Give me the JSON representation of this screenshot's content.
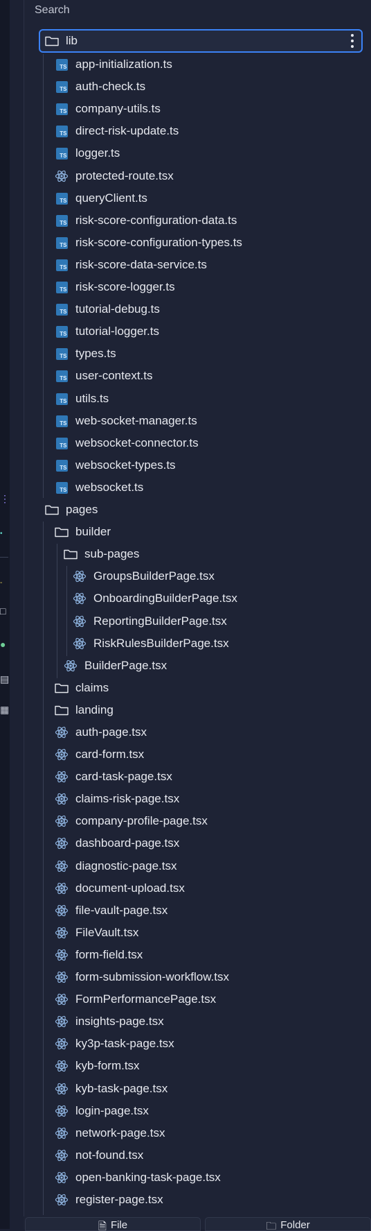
{
  "search": {
    "label": "Search"
  },
  "colors": {
    "accent": "#3b82f6",
    "ts_icon": "#2f78b7",
    "react_icon": "#8fb4e0"
  },
  "selected_folder": {
    "name": "lib",
    "icon": "folder-icon",
    "menu_icon": "more-vertical-icon"
  },
  "lib_files": [
    {
      "name": "app-initialization.ts",
      "icon": "ts-icon"
    },
    {
      "name": "auth-check.ts",
      "icon": "ts-icon"
    },
    {
      "name": "company-utils.ts",
      "icon": "ts-icon"
    },
    {
      "name": "direct-risk-update.ts",
      "icon": "ts-icon"
    },
    {
      "name": "logger.ts",
      "icon": "ts-icon"
    },
    {
      "name": "protected-route.tsx",
      "icon": "react-icon"
    },
    {
      "name": "queryClient.ts",
      "icon": "ts-icon"
    },
    {
      "name": "risk-score-configuration-data.ts",
      "icon": "ts-icon"
    },
    {
      "name": "risk-score-configuration-types.ts",
      "icon": "ts-icon"
    },
    {
      "name": "risk-score-data-service.ts",
      "icon": "ts-icon"
    },
    {
      "name": "risk-score-logger.ts",
      "icon": "ts-icon"
    },
    {
      "name": "tutorial-debug.ts",
      "icon": "ts-icon"
    },
    {
      "name": "tutorial-logger.ts",
      "icon": "ts-icon"
    },
    {
      "name": "types.ts",
      "icon": "ts-icon"
    },
    {
      "name": "user-context.ts",
      "icon": "ts-icon"
    },
    {
      "name": "utils.ts",
      "icon": "ts-icon"
    },
    {
      "name": "web-socket-manager.ts",
      "icon": "ts-icon"
    },
    {
      "name": "websocket-connector.ts",
      "icon": "ts-icon"
    },
    {
      "name": "websocket-types.ts",
      "icon": "ts-icon"
    },
    {
      "name": "websocket.ts",
      "icon": "ts-icon"
    }
  ],
  "pages_folder": {
    "name": "pages",
    "icon": "folder-icon"
  },
  "builder_folder": {
    "name": "builder",
    "icon": "folder-icon"
  },
  "sub_pages_folder": {
    "name": "sub-pages",
    "icon": "folder-icon"
  },
  "sub_pages_files": [
    {
      "name": "GroupsBuilderPage.tsx",
      "icon": "react-icon"
    },
    {
      "name": "OnboardingBuilderPage.tsx",
      "icon": "react-icon"
    },
    {
      "name": "ReportingBuilderPage.tsx",
      "icon": "react-icon"
    },
    {
      "name": "RiskRulesBuilderPage.tsx",
      "icon": "react-icon"
    }
  ],
  "builder_page": {
    "name": "BuilderPage.tsx",
    "icon": "react-icon"
  },
  "pages_subfolders": [
    {
      "name": "claims",
      "icon": "folder-icon"
    },
    {
      "name": "landing",
      "icon": "folder-icon"
    }
  ],
  "pages_files": [
    {
      "name": "auth-page.tsx",
      "icon": "react-icon"
    },
    {
      "name": "card-form.tsx",
      "icon": "react-icon"
    },
    {
      "name": "card-task-page.tsx",
      "icon": "react-icon"
    },
    {
      "name": "claims-risk-page.tsx",
      "icon": "react-icon"
    },
    {
      "name": "company-profile-page.tsx",
      "icon": "react-icon"
    },
    {
      "name": "dashboard-page.tsx",
      "icon": "react-icon"
    },
    {
      "name": "diagnostic-page.tsx",
      "icon": "react-icon"
    },
    {
      "name": "document-upload.tsx",
      "icon": "react-icon"
    },
    {
      "name": "file-vault-page.tsx",
      "icon": "react-icon"
    },
    {
      "name": "FileVault.tsx",
      "icon": "react-icon"
    },
    {
      "name": "form-field.tsx",
      "icon": "react-icon"
    },
    {
      "name": "form-submission-workflow.tsx",
      "icon": "react-icon"
    },
    {
      "name": "FormPerformancePage.tsx",
      "icon": "react-icon"
    },
    {
      "name": "insights-page.tsx",
      "icon": "react-icon"
    },
    {
      "name": "ky3p-task-page.tsx",
      "icon": "react-icon"
    },
    {
      "name": "kyb-form.tsx",
      "icon": "react-icon"
    },
    {
      "name": "kyb-task-page.tsx",
      "icon": "react-icon"
    },
    {
      "name": "login-page.tsx",
      "icon": "react-icon"
    },
    {
      "name": "network-page.tsx",
      "icon": "react-icon"
    },
    {
      "name": "not-found.tsx",
      "icon": "react-icon"
    },
    {
      "name": "open-banking-task-page.tsx",
      "icon": "react-icon"
    },
    {
      "name": "register-page.tsx",
      "icon": "react-icon"
    }
  ],
  "bottom_buttons": [
    {
      "label": "File",
      "icon": "file-add-icon"
    },
    {
      "label": "Folder",
      "icon": "folder-add-icon"
    }
  ]
}
